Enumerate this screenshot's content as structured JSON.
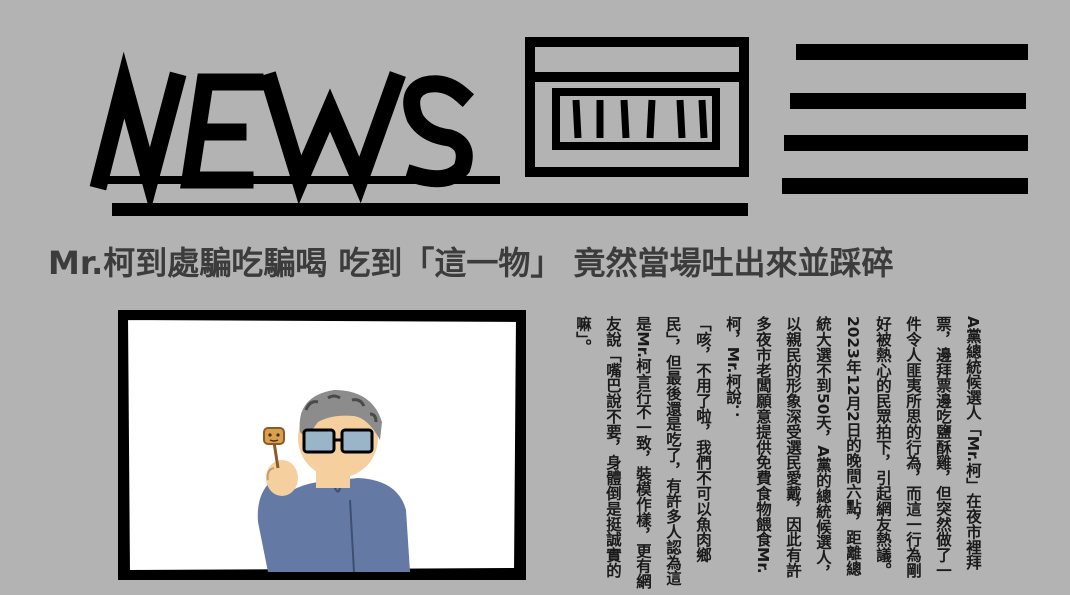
{
  "masthead": {
    "logo_text": "NEWS",
    "icon_newspaper": "newspaper-icon",
    "icon_menu": "hamburger-menu-icon"
  },
  "headline": "Mr.柯到處騙吃騙喝 吃到「這一物」 竟然當場吐出來並踩碎",
  "photo": {
    "subject": "man-with-glasses-holding-skewer-illustration"
  },
  "article": {
    "paragraphs": [
      "A黨總統候選人「Mr.柯」在夜市裡拜票，邊拜票邊吃鹽酥雞，但突然做了一件令人匪夷所思的行為，而這一行為剛好被熱心的民眾拍下，引起網友熱議。",
      "2023年12月2日的晚間六點，距離總統大選不到50天，A黨的總統候選人，以親民的形象深受選民愛戴，因此有許多夜市老闆願意提供免費食物餵食Mr.柯，Mr.柯說：",
      "「咳，不用了啦，我們不可以魚肉鄉民」，但最後還是吃了，有許多人認為這是Mr.柯言行不一致，裝模作樣，更有網友說「嘴巴說不要，身體倒是挺誠實的嘛」。"
    ]
  },
  "colors": {
    "background": "#b3b3b3",
    "ink": "#000000",
    "headline": "#3c3c3c",
    "photo_bg": "#ffffff",
    "hair": "#8c8c8c",
    "skin": "#f5cf9e",
    "shirt": "#6479a4",
    "glasses_lens": "#9ab4c8"
  }
}
